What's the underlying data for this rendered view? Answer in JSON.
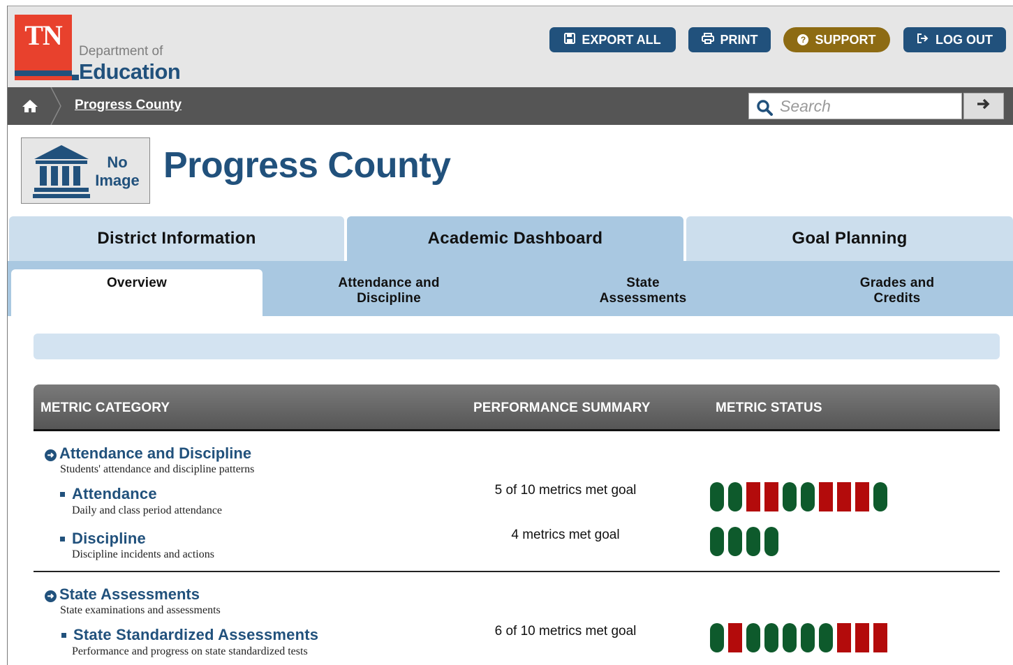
{
  "header": {
    "logo_text": "TN",
    "dept_of": "Department of",
    "education": "Education",
    "buttons": {
      "export_all": "EXPORT ALL",
      "print": "PRINT",
      "support": "SUPPORT",
      "log_out": "LOG OUT"
    }
  },
  "breadcrumb": {
    "link": "Progress County",
    "search_placeholder": "Search"
  },
  "page": {
    "no_image_line1": "No",
    "no_image_line2": "Image",
    "title": "Progress County"
  },
  "main_tabs": [
    {
      "label": "District Information",
      "active": false
    },
    {
      "label": "Academic Dashboard",
      "active": true
    },
    {
      "label": "Goal Planning",
      "active": false
    }
  ],
  "sub_tabs": [
    {
      "line1": "Overview",
      "line2": "",
      "active": true
    },
    {
      "line1": "Attendance and",
      "line2": "Discipline",
      "active": false
    },
    {
      "line1": "State",
      "line2": "Assessments",
      "active": false
    },
    {
      "line1": "Grades and",
      "line2": "Credits",
      "active": false
    }
  ],
  "table": {
    "headers": {
      "category": "METRIC CATEGORY",
      "performance": "PERFORMANCE SUMMARY",
      "status": "METRIC STATUS"
    },
    "categories": [
      {
        "title": "Attendance and Discipline",
        "description": "Students' attendance and discipline patterns",
        "items": [
          {
            "title": "Attendance",
            "description": "Daily and class period attendance",
            "summary": "5 of 10 metrics met goal",
            "status": [
              "met",
              "met",
              "not_met",
              "not_met",
              "met",
              "met",
              "not_met",
              "not_met",
              "not_met",
              "met"
            ]
          },
          {
            "title": "Discipline",
            "description": "Discipline incidents and actions",
            "summary": "4 metrics met goal",
            "status": [
              "met",
              "met",
              "met",
              "met"
            ]
          }
        ]
      },
      {
        "title": "State Assessments",
        "description": "State examinations and assessments",
        "items": [
          {
            "title": "State Standardized Assessments",
            "description": "Performance and progress on state standardized tests",
            "summary": "6 of 10 metrics met goal",
            "status": [
              "met",
              "not_met",
              "met",
              "met",
              "met",
              "met",
              "met",
              "not_met",
              "not_met",
              "not_met"
            ]
          }
        ]
      }
    ]
  },
  "colors": {
    "brand_navy": "#21517c",
    "support_gold": "#8d6b13",
    "met_green": "#0e5a2c",
    "not_met_red": "#b30b0b"
  },
  "icons": [
    "save-icon",
    "print-icon",
    "question-icon",
    "logout-icon",
    "home-icon",
    "search-icon",
    "arrow-right-icon",
    "building-icon",
    "circle-arrow-icon"
  ]
}
